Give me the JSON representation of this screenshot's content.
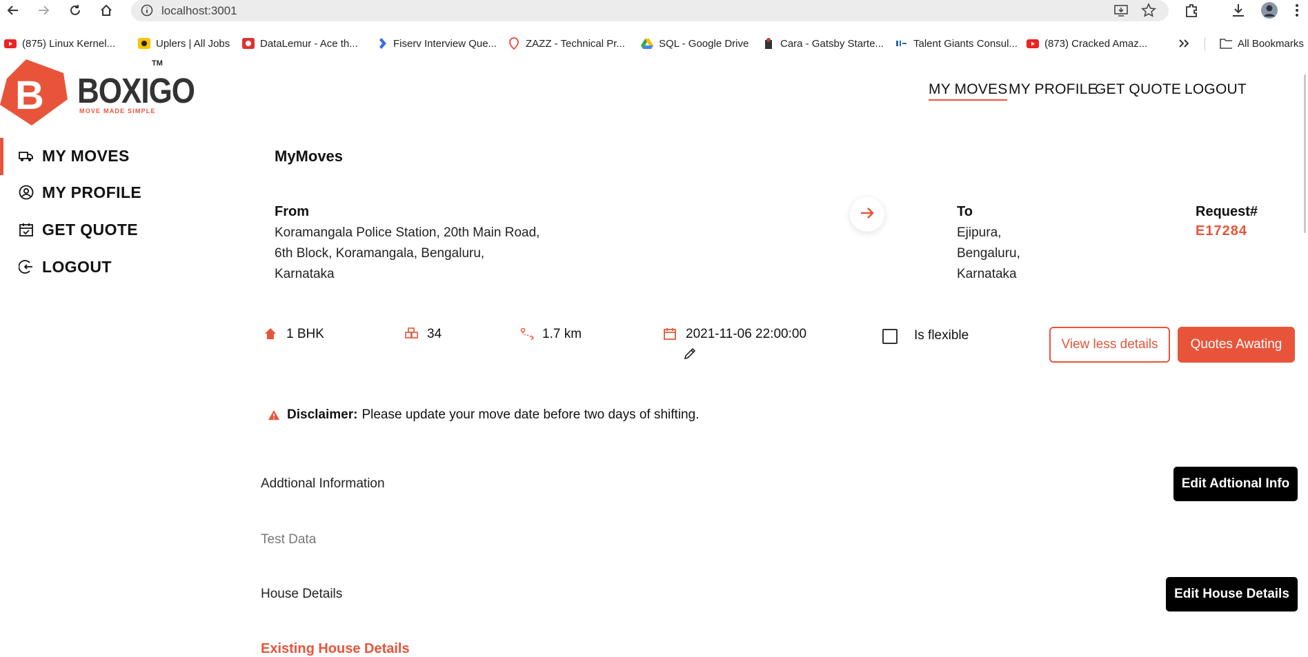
{
  "browser": {
    "url": "localhost:3001",
    "bookmarks": [
      {
        "label": "(875) Linux Kernel...",
        "icon": "youtube-icon"
      },
      {
        "label": "Uplers | All Jobs",
        "icon": "uplers-icon"
      },
      {
        "label": "DataLemur - Ace th...",
        "icon": "datalemur-icon"
      },
      {
        "label": "Fiserv Interview Que...",
        "icon": "leetcode-icon"
      },
      {
        "label": "ZAZZ - Technical Pr...",
        "icon": "location-icon"
      },
      {
        "label": "SQL - Google Drive",
        "icon": "google-drive-icon"
      },
      {
        "label": "Cara - Gatsby Starte...",
        "icon": "gatsby-icon"
      },
      {
        "label": "Talent Giants Consul...",
        "icon": "talent-icon"
      },
      {
        "label": "(873) Cracked Amaz...",
        "icon": "youtube-icon"
      }
    ],
    "all_bookmarks": "All Bookmarks"
  },
  "brand": {
    "name": "BOXIGO",
    "tagline": "MOVE MADE SIMPLE",
    "tm": "TM",
    "accent": "#e8543a"
  },
  "topnav": {
    "my_moves": "MY MOVES",
    "my_profile": "MY PROFILE",
    "get_quote": "GET QUOTE",
    "logout": "LOGOUT"
  },
  "sidebar": {
    "items": [
      {
        "label": "MY MOVES",
        "icon": "truck-icon"
      },
      {
        "label": "MY PROFILE",
        "icon": "user-circle-icon"
      },
      {
        "label": "GET QUOTE",
        "icon": "calendar-check-icon"
      },
      {
        "label": "LOGOUT",
        "icon": "logout-icon"
      }
    ]
  },
  "main": {
    "title": "MyMoves",
    "from_label": "From",
    "from_lines": [
      "Koramangala Police Station, 20th Main Road,",
      "6th Block, Koramangala, Bengaluru,",
      "Karnataka"
    ],
    "to_label": "To",
    "to_lines": [
      "Ejipura,",
      "Bengaluru,",
      "Karnataka"
    ],
    "request_label": "Request#",
    "request_id": "E17284",
    "stats": {
      "property": "1 BHK",
      "items": "34",
      "distance": "1.7 km",
      "datetime": "2021-11-06 22:00:00",
      "flexible_label": "Is flexible"
    },
    "buttons": {
      "view_less": "View less details",
      "quotes": "Quotes Awating"
    },
    "disclaimer": {
      "title": "Disclaimer:",
      "text": "Please update your move date before two days of shifting."
    },
    "additional": {
      "title": "Addtional Information",
      "button": "Edit Adtional Info",
      "value": "Test Data"
    },
    "house": {
      "title": "House Details",
      "button": "Edit House Details",
      "subtitle": "Existing House Details"
    }
  }
}
